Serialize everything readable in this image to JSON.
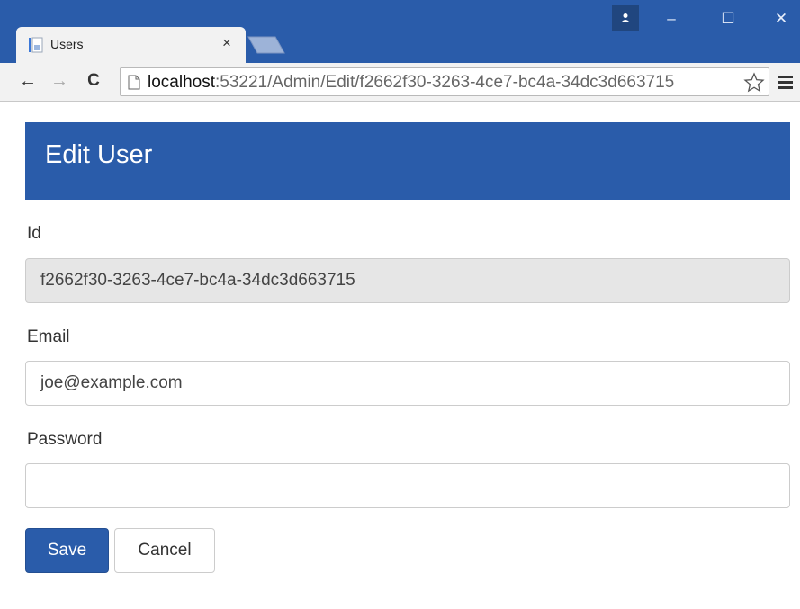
{
  "browser": {
    "tab_title": "Users",
    "tab_close": "×",
    "url_host": "localhost",
    "url_rest": ":53221/Admin/Edit/f2662f30-3263-4ce7-bc4a-34dc3d663715",
    "window_buttons": {
      "minimize": "–",
      "maximize": "☐",
      "close": "✕"
    },
    "nav": {
      "back": "←",
      "forward": "→",
      "reload": "C"
    }
  },
  "page": {
    "title": "Edit User",
    "fields": {
      "id_label": "Id",
      "id_value": "f2662f30-3263-4ce7-bc4a-34dc3d663715",
      "email_label": "Email",
      "email_value": "joe@example.com",
      "password_label": "Password",
      "password_value": ""
    },
    "buttons": {
      "save": "Save",
      "cancel": "Cancel"
    }
  },
  "colors": {
    "primary": "#2a5caa",
    "readonly_bg": "#e6e6e6",
    "border": "#cccccc"
  },
  "icons": [
    "favicon-icon",
    "profile-icon",
    "page-icon",
    "star-icon",
    "menu-icon"
  ]
}
